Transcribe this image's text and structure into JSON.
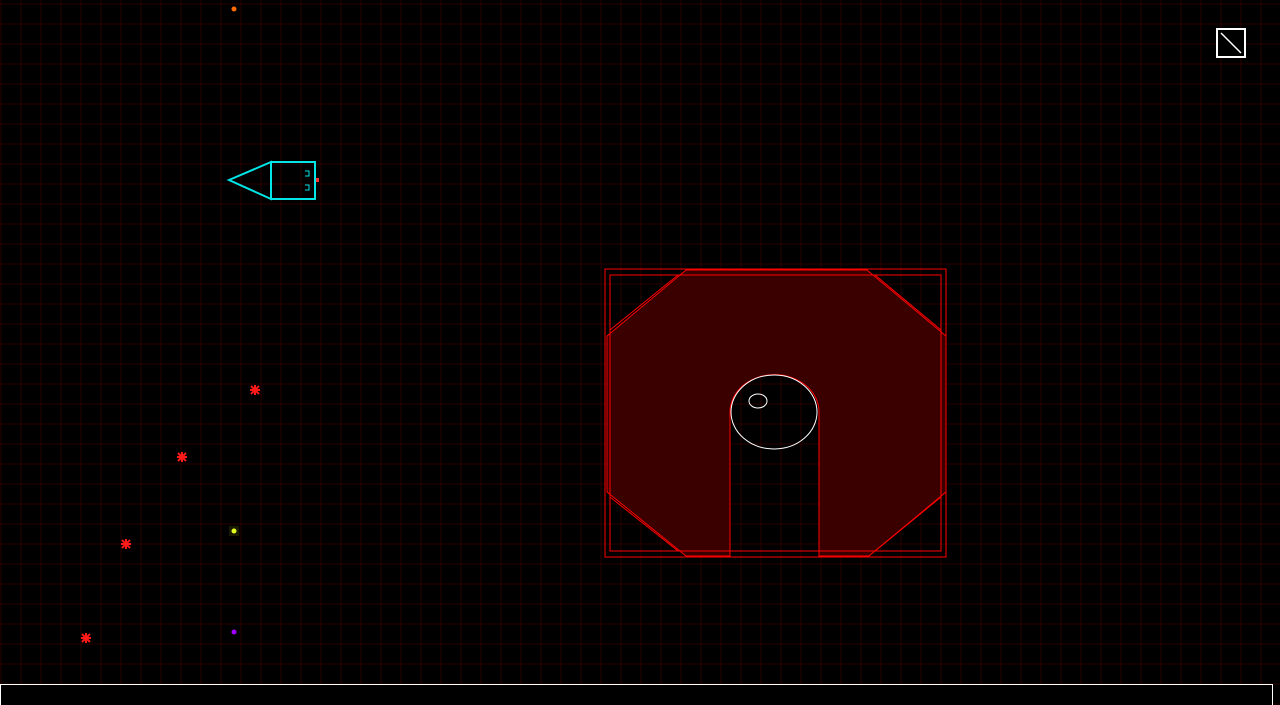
{
  "app": {
    "background_color": "#000000",
    "grid_color": "#2a0000"
  },
  "player_ship": {
    "icon": "ship-icon",
    "color": "#00e5e5"
  },
  "enemies": {
    "color": "#ff1a1a",
    "count": 4
  },
  "pickups": [
    {
      "name": "orange-pickup",
      "color": "#ff6a00"
    },
    {
      "name": "yellow-pickup",
      "color": "#e0ff20"
    },
    {
      "name": "purple-pickup",
      "color": "#a000ff"
    }
  ],
  "fortress": {
    "outline_color": "#ff0000",
    "fill_color": "#3a0000",
    "orb_color": "#ffffff"
  },
  "toolbar": {
    "fullscreen_icon": "fullscreen-icon"
  },
  "console": {
    "text": ""
  }
}
